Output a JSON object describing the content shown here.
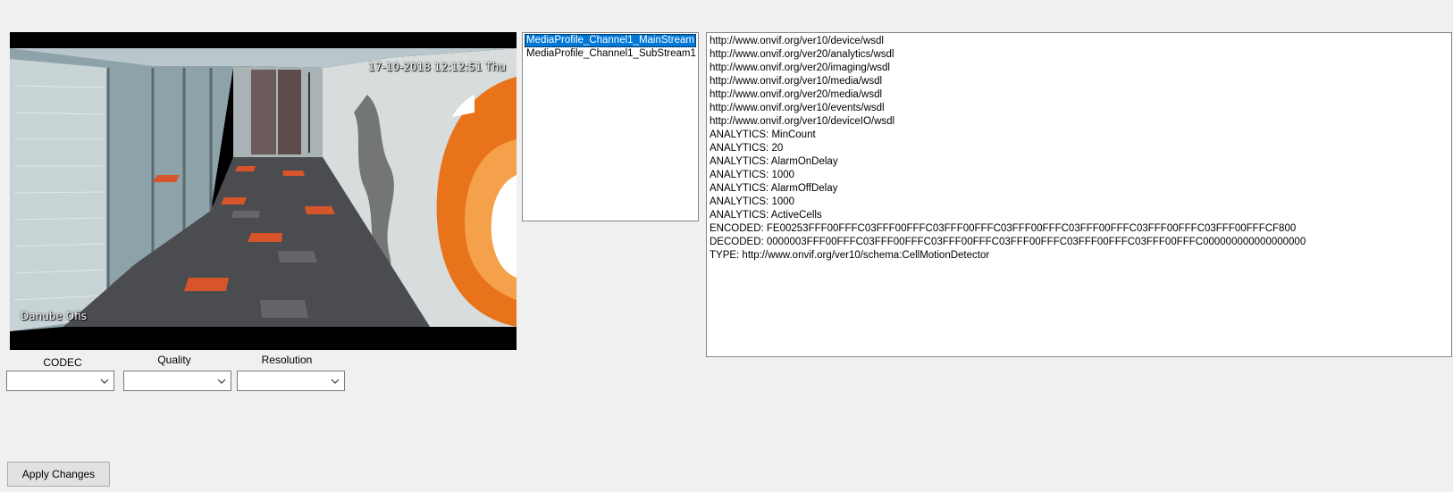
{
  "video": {
    "timestamp": "17-10-2018 12:12:51 Thu",
    "camera_name": "Danube Ofis"
  },
  "profiles": {
    "items": [
      {
        "label": "MediaProfile_Channel1_MainStream",
        "selected": true
      },
      {
        "label": "MediaProfile_Channel1_SubStream1",
        "selected": false
      }
    ]
  },
  "info": {
    "lines": [
      "http://www.onvif.org/ver10/device/wsdl",
      "http://www.onvif.org/ver20/analytics/wsdl",
      "http://www.onvif.org/ver20/imaging/wsdl",
      "http://www.onvif.org/ver10/media/wsdl",
      "http://www.onvif.org/ver20/media/wsdl",
      "http://www.onvif.org/ver10/events/wsdl",
      "http://www.onvif.org/ver10/deviceIO/wsdl",
      "ANALYTICS: MinCount",
      "ANALYTICS: 20",
      "ANALYTICS: AlarmOnDelay",
      "ANALYTICS: 1000",
      "ANALYTICS: AlarmOffDelay",
      "ANALYTICS: 1000",
      "ANALYTICS: ActiveCells",
      "ENCODED: FE00253FFF00FFFC03FFF00FFFC03FFF00FFFC03FFF00FFFC03FFF00FFFC03FFF00FFFC03FFF00FFFCF800",
      "DECODED: 0000003FFF00FFFC03FFF00FFFC03FFF00FFFC03FFF00FFFC03FFF00FFFC03FFF00FFFC000000000000000000",
      "TYPE: http://www.onvif.org/ver10/schema:CellMotionDetector"
    ]
  },
  "settings": {
    "codec_label": "CODEC",
    "codec_value": "",
    "quality_label": "Quality",
    "quality_value": "",
    "resolution_label": "Resolution",
    "resolution_value": ""
  },
  "actions": {
    "apply_label": "Apply Changes"
  },
  "colors": {
    "selection": "#0078d7",
    "window_bg": "#f0f0f0",
    "accent_orange": "#e8731a"
  },
  "icons": {
    "combo_arrow": "chevron-down-icon"
  }
}
